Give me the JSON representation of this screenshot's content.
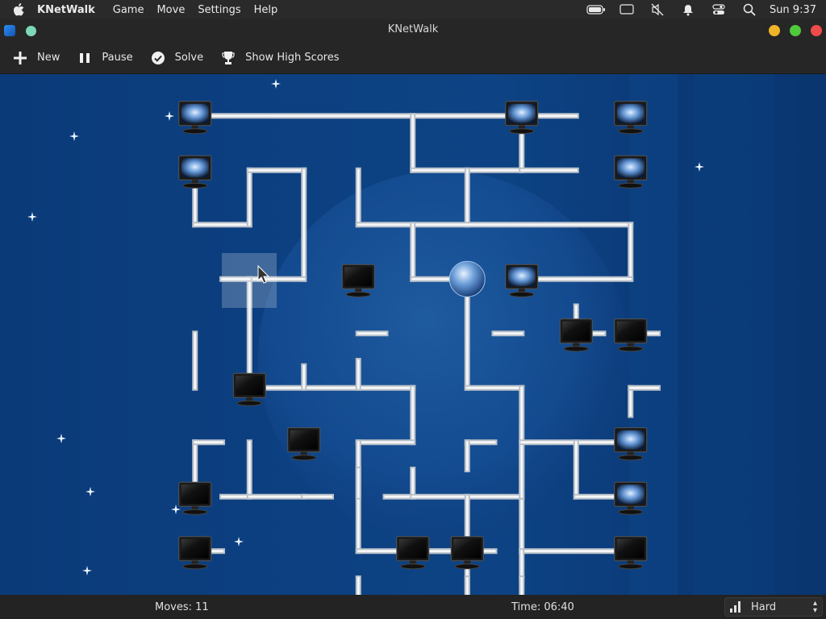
{
  "menubar": {
    "app_name": "KNetWalk",
    "items": [
      "Game",
      "Move",
      "Settings",
      "Help"
    ],
    "clock": "Sun 9:37",
    "status_icons": [
      "battery-icon",
      "screen-mirroring-icon",
      "sound-muted-icon",
      "notifications-icon",
      "control-center-icon",
      "spotlight-search-icon"
    ]
  },
  "window": {
    "title": "KNetWalk"
  },
  "toolbar": {
    "new_label": "New",
    "pause_label": "Pause",
    "solve_label": "Solve",
    "high_scores_label": "Show High Scores"
  },
  "status": {
    "moves": "Moves: 11",
    "time": "Time: 06:40",
    "difficulty": "Hard"
  },
  "colors": {
    "board_bg": "#0c3f80",
    "pipe": "#dcdcdc",
    "selection": "#ffffff"
  }
}
